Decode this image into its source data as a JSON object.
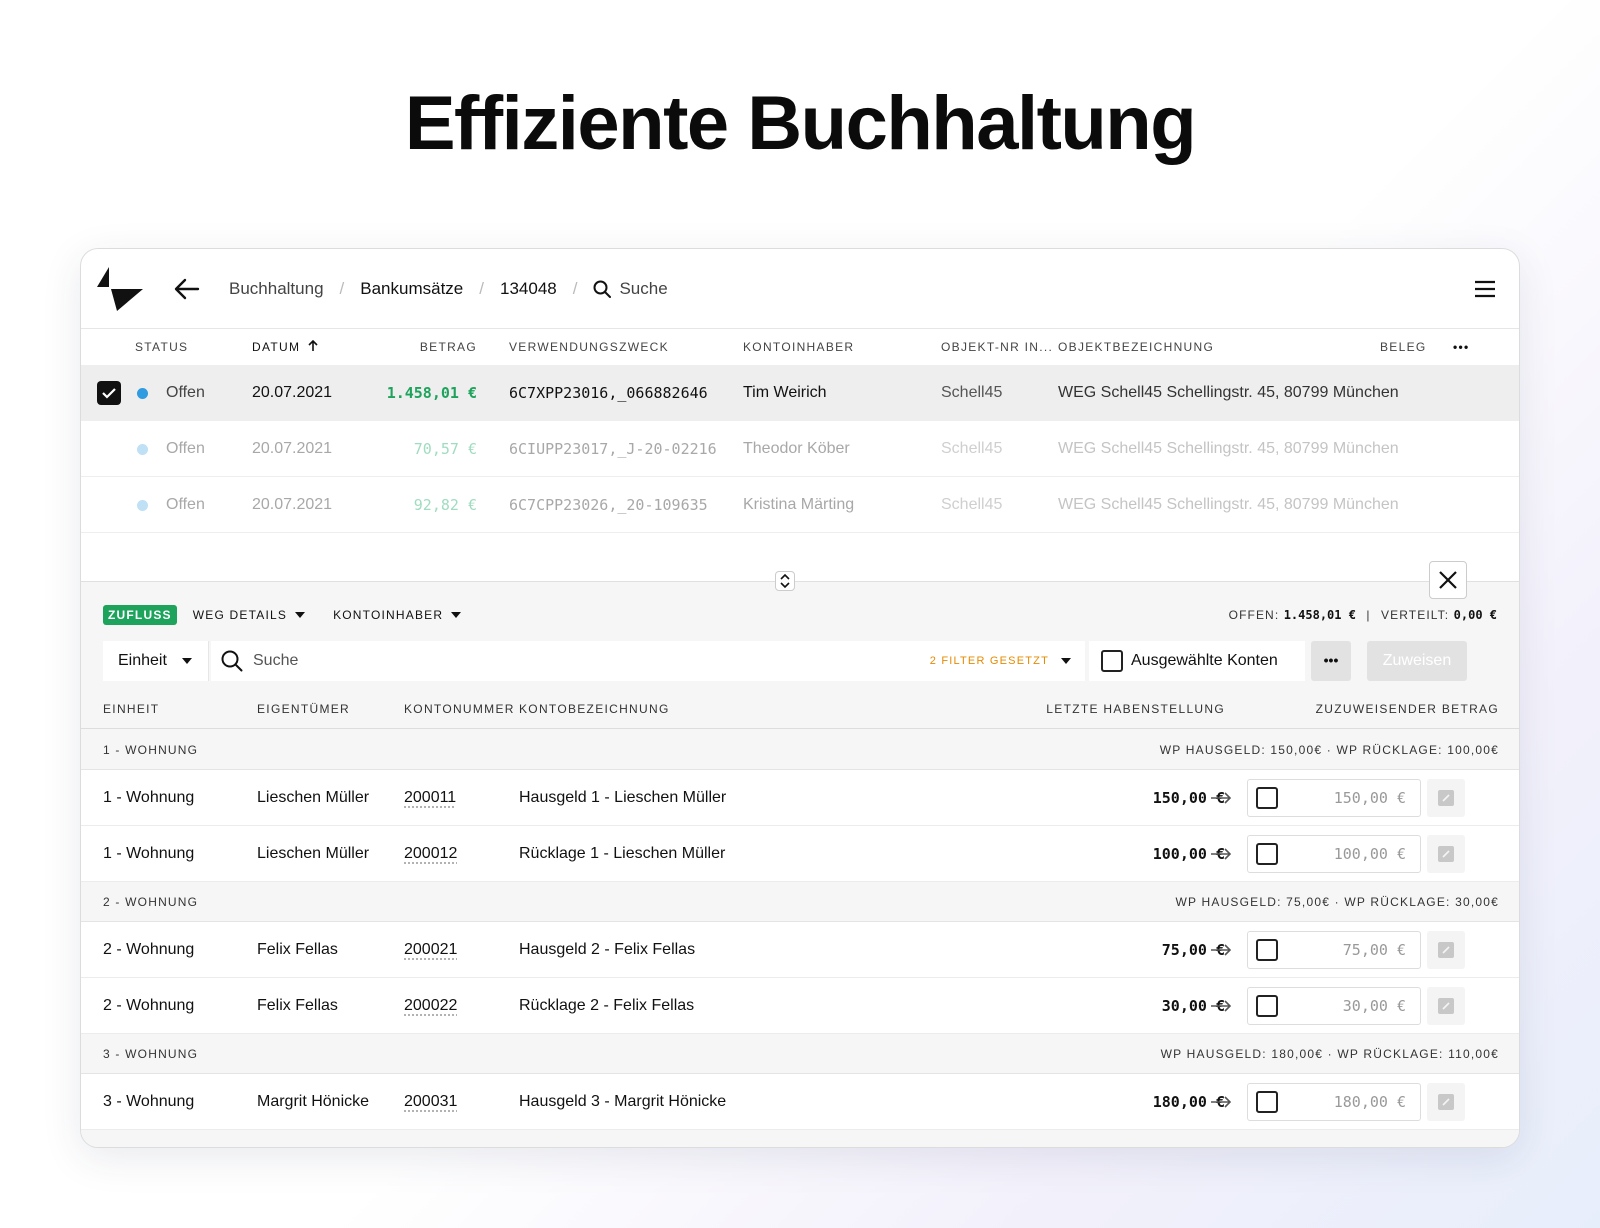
{
  "headline": "Effiziente Buchhaltung",
  "breadcrumb": {
    "items": [
      "Buchhaltung",
      "Bankumsätze",
      "134048"
    ],
    "separator": "/",
    "search_label": "Suche"
  },
  "transactions": {
    "headers": {
      "status": "STATUS",
      "datum": "DATUM",
      "betrag": "BETRAG",
      "verwendungszweck": "VERWENDUNGSZWECK",
      "kontoinhaber": "KONTOINHABER",
      "objekt_nr": "OBJEKT-NR IN...",
      "objektbezeichnung": "OBJEKTBEZEICHNUNG",
      "beleg": "BELEG",
      "more": "•••"
    },
    "rows": [
      {
        "status": "Offen",
        "datum": "20.07.2021",
        "betrag": "1.458,01 €",
        "verwendungszweck": "6C7XPP23016,_066882646",
        "kontoinhaber": "Tim Weirich",
        "objekt_nr": "Schell45",
        "objektbezeichnung": "WEG Schell45 Schellingstr. 45, 80799 München"
      },
      {
        "status": "Offen",
        "datum": "20.07.2021",
        "betrag": "70,57 €",
        "verwendungszweck": "6CIUPP23017,_J-20-02216",
        "kontoinhaber": "Theodor Köber",
        "objekt_nr": "Schell45",
        "objektbezeichnung": "WEG Schell45 Schellingstr. 45, 80799 München"
      },
      {
        "status": "Offen",
        "datum": "20.07.2021",
        "betrag": "92,82 €",
        "verwendungszweck": "6C7CPP23026,_20-109635",
        "kontoinhaber": "Kristina Märting",
        "objekt_nr": "Schell45",
        "objektbezeichnung": "WEG Schell45 Schellingstr. 45, 80799 München"
      }
    ]
  },
  "panel": {
    "tag": "ZUFLUSS",
    "dropdowns": [
      "WEG DETAILS",
      "KONTOINHABER"
    ],
    "summary": {
      "offen_label": "OFFEN:",
      "offen_value": "1.458,01 €",
      "divider": "|",
      "verteilt_label": "VERTEILT:",
      "verteilt_value": "0,00 €"
    },
    "filter": {
      "unit_select": "Einheit",
      "search_placeholder": "Suche",
      "filter_count": "2 FILTER GESETZT",
      "selected_accounts": "Ausgewählte Konten",
      "more": "•••",
      "assign": "Zuweisen"
    },
    "headers": {
      "einheit": "EINHEIT",
      "eigentuemer": "EIGENTÜMER",
      "kontonummer": "KONTONUMMER",
      "kontobezeichnung": "KONTOBEZEICHNUNG",
      "letzte": "LETZTE HABENSTELLUNG",
      "zuzuweisen": "ZUZUWEISENDER BETRAG"
    },
    "groups": [
      {
        "label": "1 - WOHNUNG",
        "info": "WP HAUSGELD: 150,00€  ·  WP RÜCKLAGE: 100,00€",
        "rows": [
          {
            "einheit": "1 - Wohnung",
            "eigentuemer": "Lieschen Müller",
            "kontonummer": "200011",
            "kontobezeichnung": "Hausgeld 1 - Lieschen Müller",
            "balance": "150,00 €",
            "amount": "150,00 €"
          },
          {
            "einheit": "1 - Wohnung",
            "eigentuemer": "Lieschen Müller",
            "kontonummer": "200012",
            "kontobezeichnung": "Rücklage 1 - Lieschen Müller",
            "balance": "100,00 €",
            "amount": "100,00 €"
          }
        ]
      },
      {
        "label": "2 - WOHNUNG",
        "info": "WP HAUSGELD: 75,00€  ·  WP RÜCKLAGE: 30,00€",
        "rows": [
          {
            "einheit": "2 - Wohnung",
            "eigentuemer": "Felix Fellas",
            "kontonummer": "200021",
            "kontobezeichnung": "Hausgeld 2 - Felix Fellas",
            "balance": "75,00 €",
            "amount": "75,00 €"
          },
          {
            "einheit": "2 - Wohnung",
            "eigentuemer": "Felix Fellas",
            "kontonummer": "200022",
            "kontobezeichnung": "Rücklage 2 - Felix Fellas",
            "balance": "30,00 €",
            "amount": "30,00 €"
          }
        ]
      },
      {
        "label": "3 - WOHNUNG",
        "info": "WP HAUSGELD: 180,00€  ·  WP RÜCKLAGE: 110,00€",
        "rows": [
          {
            "einheit": "3 - Wohnung",
            "eigentuemer": "Margrit Hönicke",
            "kontonummer": "200031",
            "kontobezeichnung": "Hausgeld 3 - Margrit Hönicke",
            "balance": "180,00 €",
            "amount": "180,00 €"
          }
        ]
      }
    ]
  }
}
